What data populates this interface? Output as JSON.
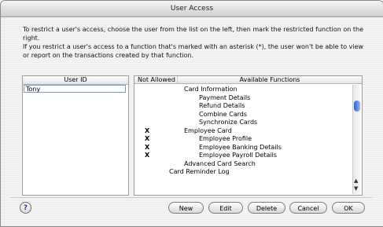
{
  "window": {
    "title": "User Access"
  },
  "intro": {
    "line1": "To restrict a user's access, choose the user from the list on the left, then mark the restricted function on the right.",
    "line2": "If you restrict a user's access to a function that's marked with an asterisk (*), the user won't be able to view or report on the transactions created by that function."
  },
  "users": {
    "header": "User ID",
    "items": [
      "Tony"
    ]
  },
  "functions": {
    "header_not_allowed": "Not Allowed",
    "header_available": "Available Functions",
    "rows": [
      {
        "mark": "",
        "label": "Card Information",
        "level": 1
      },
      {
        "mark": "",
        "label": "Payment Details",
        "level": 2
      },
      {
        "mark": "",
        "label": "Refund Details",
        "level": 2
      },
      {
        "mark": "",
        "label": "Combine Cards",
        "level": 2
      },
      {
        "mark": "",
        "label": "Synchronize Cards",
        "level": 2
      },
      {
        "mark": "X",
        "label": "Employee Card",
        "level": 1
      },
      {
        "mark": "X",
        "label": "Employee Profile",
        "level": 2
      },
      {
        "mark": "X",
        "label": "Employee Banking Details",
        "level": 2
      },
      {
        "mark": "X",
        "label": "Employee Payroll Details",
        "level": 2
      },
      {
        "mark": "",
        "label": "Advanced Card Search",
        "level": 1
      },
      {
        "mark": "",
        "label": "Card Reminder Log",
        "level": 0
      }
    ]
  },
  "buttons": {
    "help": "?",
    "new": "New",
    "edit": "Edit",
    "delete": "Delete",
    "cancel": "Cancel",
    "ok": "OK"
  }
}
